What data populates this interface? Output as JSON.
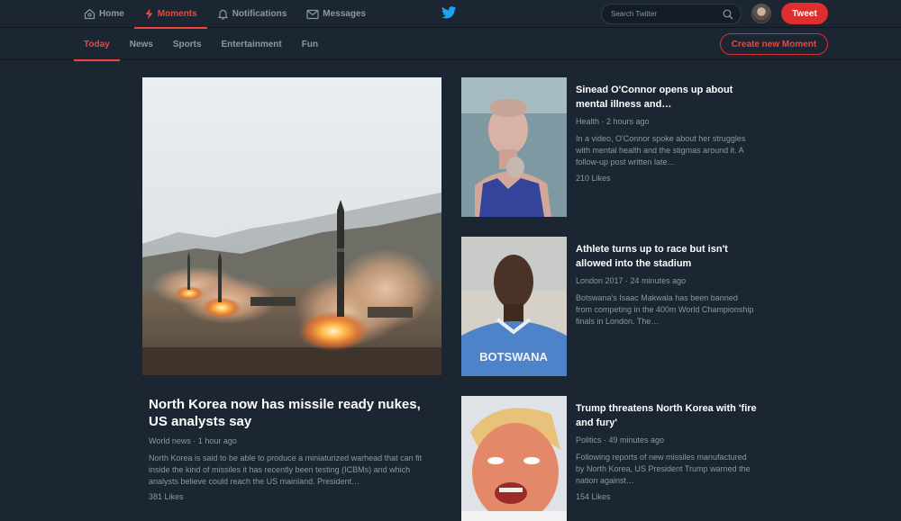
{
  "nav": {
    "items": [
      {
        "label": "Home",
        "icon": "home-icon"
      },
      {
        "label": "Moments",
        "icon": "lightning-icon",
        "active": true
      },
      {
        "label": "Notifications",
        "icon": "bell-icon"
      },
      {
        "label": "Messages",
        "icon": "envelope-icon"
      }
    ],
    "search_placeholder": "Search Twitter",
    "tweet_label": "Tweet"
  },
  "tabs": {
    "items": [
      "Today",
      "News",
      "Sports",
      "Entertainment",
      "Fun"
    ],
    "active": "Today",
    "create_label": "Create new Moment"
  },
  "colors": {
    "accent": "#f4433d",
    "background": "#1c2532",
    "muted_text": "#8b98a5"
  },
  "hero": {
    "title": "North Korea now has missile ready nukes, US analysts say",
    "meta": "World news · 1 hour ago",
    "description": "North Korea is said to be able to produce a miniaturized warhead that can fit inside the kind of missiles it has recently been testing (ICBMs) and which analysts believe could reach the US mainland. President…",
    "likes": "381 Likes"
  },
  "stories": [
    {
      "title": "Sinead O'Connor opens up about mental illness and…",
      "meta": "Health · 2 hours ago",
      "description": "In a video, O'Connor spoke about her struggles with mental health and the stigmas around it. A follow-up post written late…",
      "likes": "210 Likes"
    },
    {
      "title": "Athlete turns up to race but isn't allowed into the stadium",
      "meta": "London 2017 · 24 minutes ago",
      "description": "Botswana's Isaac Makwala has been banned from competing in the 400m World Championship finals in London. The…",
      "likes": "",
      "shirt_text": "BOTSWANA"
    },
    {
      "title": "Trump threatens North Korea with 'fire and fury'",
      "meta": "Politics · 49 minutes ago",
      "description": "Following reports of new missiles manufactured by North Korea, US President Trump warned the nation against…",
      "likes": "154 Likes"
    }
  ]
}
